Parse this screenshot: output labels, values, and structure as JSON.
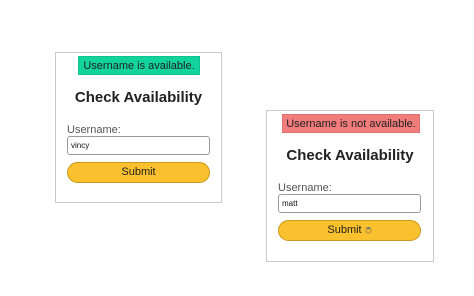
{
  "left_card": {
    "banner": "Username is available.",
    "title": "Check Availability",
    "username_label": "Username:",
    "username_value": "vincy",
    "submit_label": "Submit",
    "banner_color": "#12d39b"
  },
  "right_card": {
    "banner": "Username is not available.",
    "title": "Check Availability",
    "username_label": "Username:",
    "username_value": "matt",
    "submit_label": "Submit",
    "banner_color": "#f27c7c",
    "loading_icon": "spinner-icon"
  },
  "button_color": "#fbc02d"
}
